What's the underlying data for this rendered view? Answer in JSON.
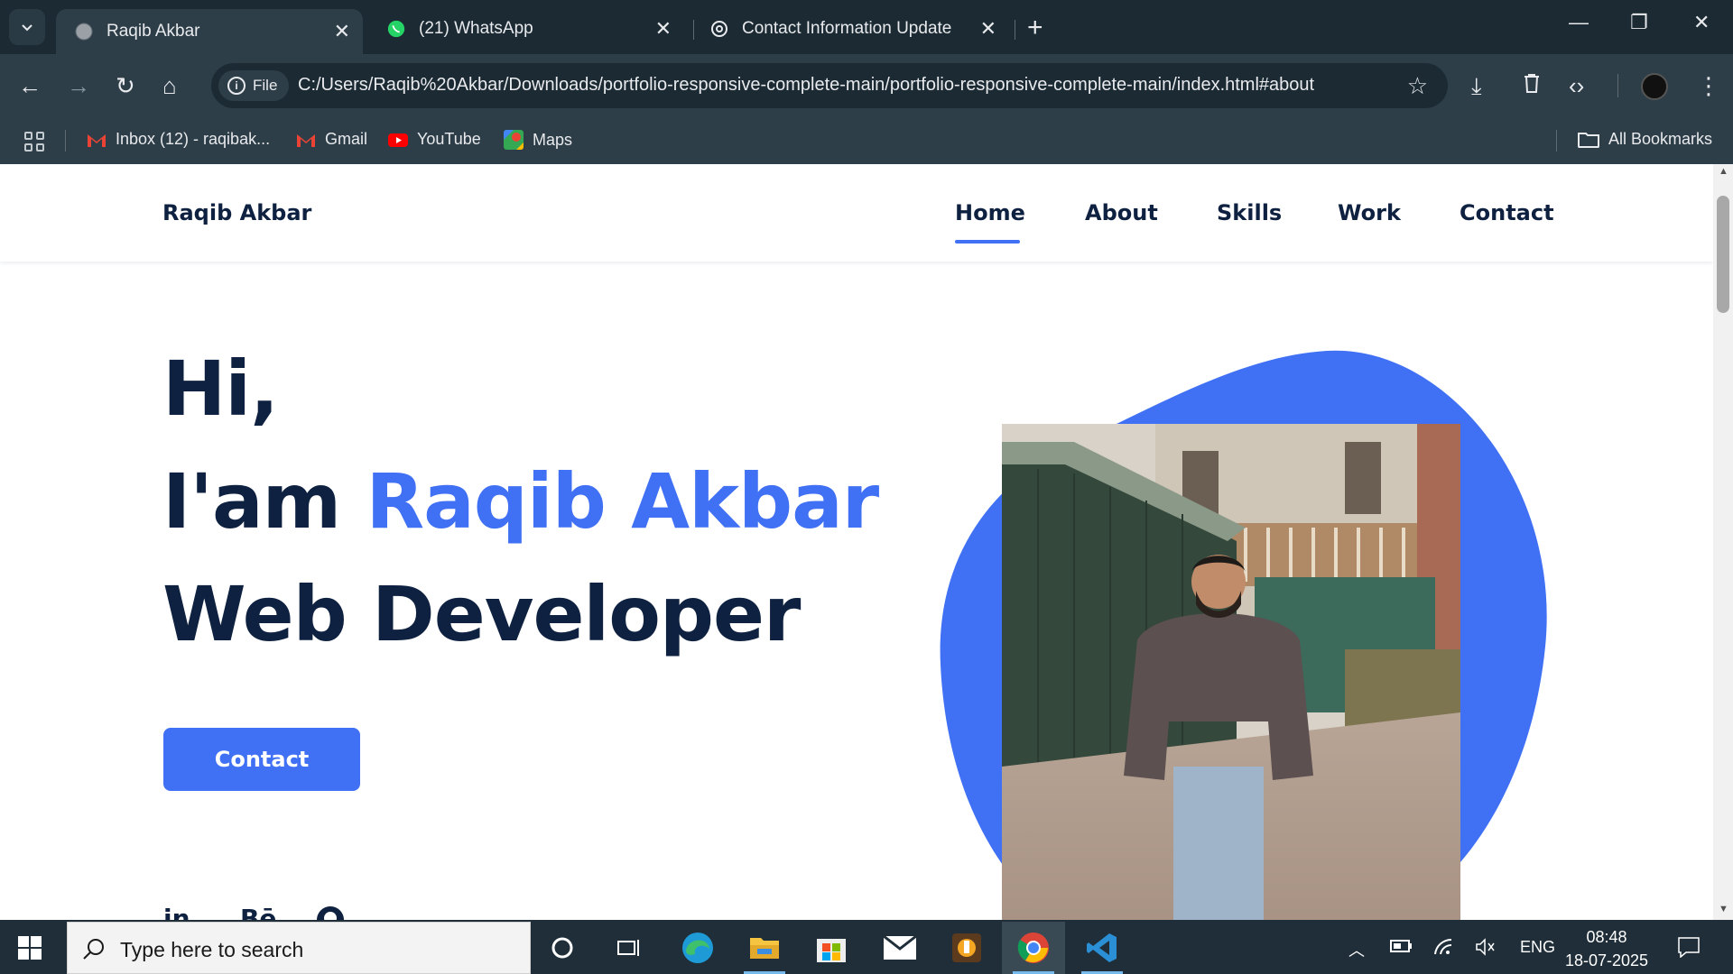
{
  "browser": {
    "tabs": [
      {
        "title": "Raqib Akbar",
        "active": true
      },
      {
        "title": "(21) WhatsApp",
        "active": false
      },
      {
        "title": "Contact Information Update",
        "active": false
      }
    ],
    "omnibox": {
      "scheme_chip": "File",
      "url": "C:/Users/Raqib%20Akbar/Downloads/portfolio-responsive-complete-main/portfolio-responsive-complete-main/index.html#about"
    },
    "bookmarks": [
      {
        "label": "Inbox (12) - raqibak...",
        "icon": "gmail-icon"
      },
      {
        "label": "Gmail",
        "icon": "gmail-icon"
      },
      {
        "label": "YouTube",
        "icon": "youtube-icon"
      },
      {
        "label": "Maps",
        "icon": "maps-icon"
      }
    ],
    "all_bookmarks": "All Bookmarks"
  },
  "site": {
    "logo": "Raqib Akbar",
    "nav": [
      "Home",
      "About",
      "Skills",
      "Work",
      "Contact"
    ],
    "active_nav": "Home",
    "hero": {
      "greeting": "Hi,",
      "intro_prefix": "I'am ",
      "name": "Raqib Akbar",
      "role": "Web Developer"
    },
    "cta_label": "Contact",
    "social": [
      "in",
      "Bē",
      "github-icon"
    ],
    "colors": {
      "accent": "#4070f4",
      "text": "#0e2140"
    }
  },
  "taskbar": {
    "search_placeholder": "Type here to search",
    "language": "ENG",
    "time": "08:48",
    "date": "18-07-2025"
  }
}
